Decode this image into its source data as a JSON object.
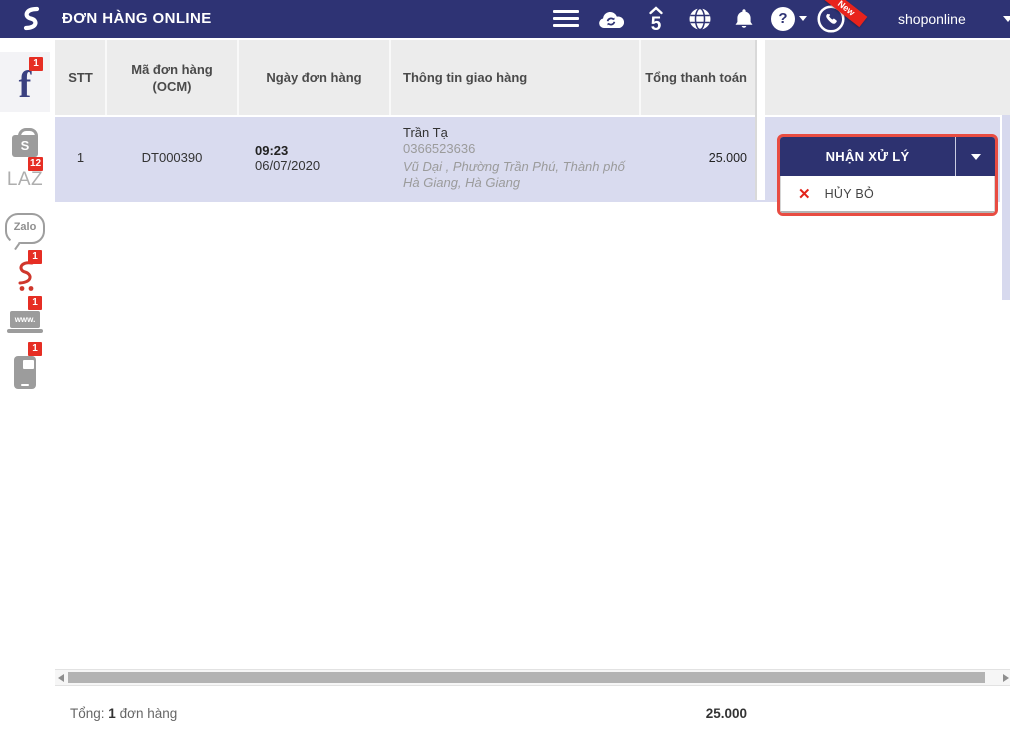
{
  "header": {
    "title": "ĐƠN HÀNG ONLINE",
    "account": "shoponline",
    "new_badge": "New",
    "help_glyph": "?"
  },
  "sidebar": {
    "items": [
      {
        "id": "facebook",
        "badge": "1"
      },
      {
        "id": "shopee",
        "glyph": "S"
      },
      {
        "id": "lazada",
        "label": "LAZ",
        "badge": "12"
      },
      {
        "id": "zalo",
        "label": "Zalo"
      },
      {
        "id": "sendo",
        "badge": "1"
      },
      {
        "id": "website",
        "label": "www.",
        "badge": "1"
      },
      {
        "id": "mobile",
        "badge": "1"
      }
    ]
  },
  "table": {
    "columns": [
      "STT",
      "Mã đơn hàng (OCM)",
      "Ngày đơn hàng",
      "Thông tin giao hàng",
      "Tổng thanh toán"
    ],
    "rows": [
      {
        "stt": "1",
        "code": "DT000390",
        "time": "09:23",
        "date": "06/07/2020",
        "customer": "Trần Tạ",
        "phone": "0366523636",
        "address": "Vũ Dại , Phường Trần Phú, Thành phố Hà Giang, Hà Giang",
        "total": "25.000"
      }
    ]
  },
  "actions": {
    "primary": "NHẬN XỬ LÝ",
    "cancel": "HỦY BỎ",
    "cancel_icon": "✕"
  },
  "footer": {
    "label": "Tổng:",
    "count": "1",
    "unit": "đơn hàng",
    "amount": "25.000"
  },
  "colors": {
    "navy": "#2e3374",
    "row_highlight": "#d9dbef",
    "annotation_red": "#e84c42",
    "badge_red": "#e62e24"
  }
}
